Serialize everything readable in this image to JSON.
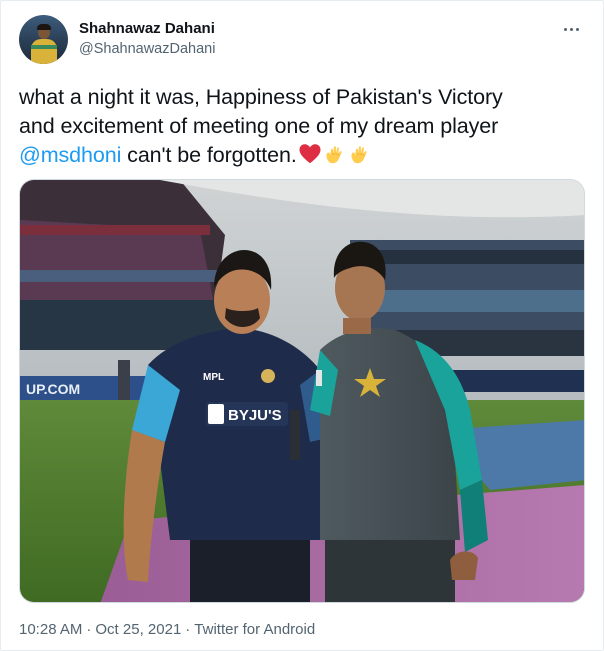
{
  "author": {
    "display_name": "Shahnawaz Dahani",
    "handle": "@ShahnawazDahani"
  },
  "tweet": {
    "line1": "what a night it was, Happiness of Pakistan's Victory",
    "line2": "and excitement of meeting one of my dream player",
    "mention": "@msdhoni",
    "line3_text": " can't be forgotten.",
    "emojis": [
      "red-heart",
      "raised-hand",
      "raised-hand"
    ]
  },
  "media": {
    "alt": "Photo of two cricketers posing in a stadium",
    "left_jersey_text": "BYJU'S",
    "left_jersey_sponsor": "MPL",
    "board_text": "UP.COM"
  },
  "footer": {
    "time": "10:28 AM",
    "separator": "·",
    "date": "Oct 25, 2021",
    "source": "Twitter for Android"
  },
  "colors": {
    "accent": "#1d9bf0",
    "muted": "#536471",
    "text": "#0f1419"
  }
}
